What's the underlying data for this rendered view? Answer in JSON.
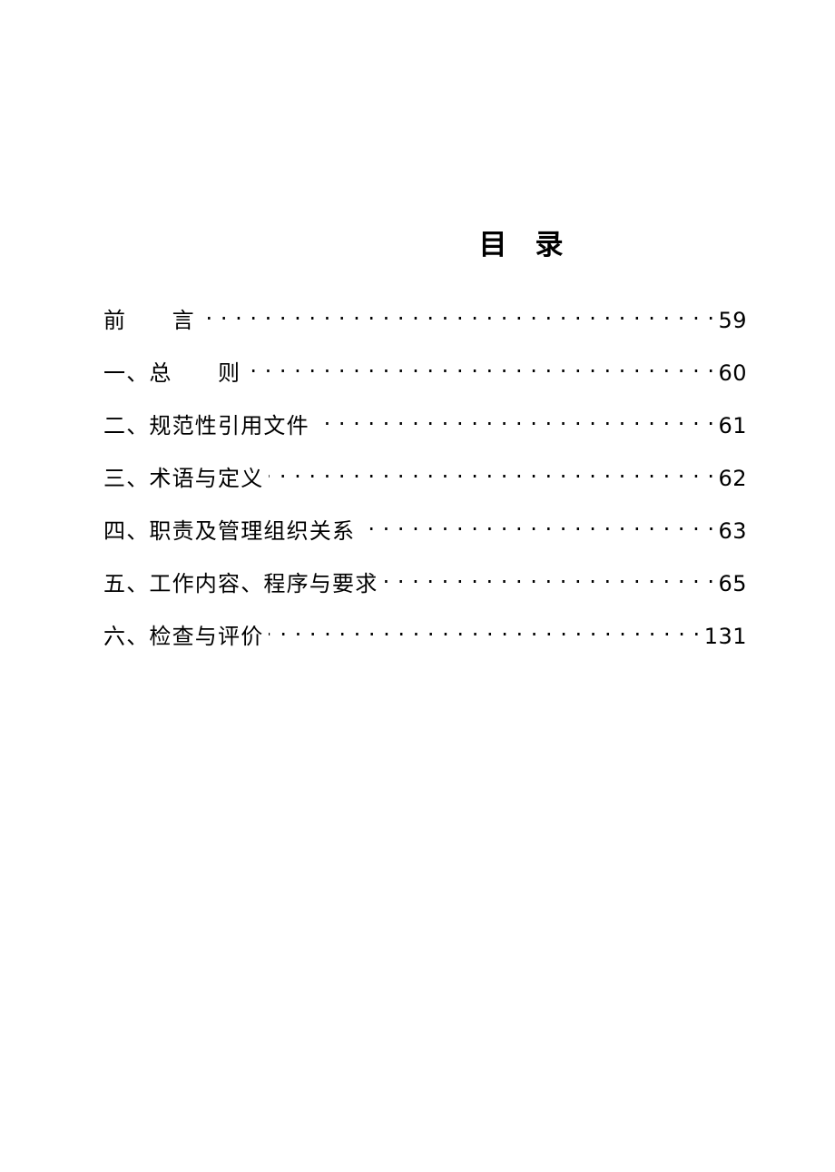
{
  "document": {
    "title": "目　录",
    "page_background": "#ffffff",
    "text_color": "#000000"
  },
  "toc": {
    "heading": "目　录",
    "entries": [
      {
        "label": "前　　言",
        "page": "59"
      },
      {
        "label": "一、总　　则",
        "page": "60"
      },
      {
        "label": "二、规范性引用文件",
        "page": "61"
      },
      {
        "label": "三、术语与定义",
        "page": "62"
      },
      {
        "label": "四、职责及管理组织关系",
        "page": "63"
      },
      {
        "label": "五、工作内容、程序与要求",
        "page": "65"
      },
      {
        "label": "六、检查与评价",
        "page": "131"
      }
    ]
  }
}
